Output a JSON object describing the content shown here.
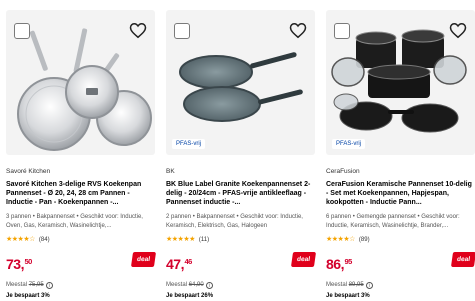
{
  "products": [
    {
      "brand": "Savoré Kitchen",
      "title": "Savoré Kitchen 3-delige RVS Koekenpan Pannenset - Ø 20, 24, 28 cm Pannen - Inductie - Pan - Koekenpannen -...",
      "description": "3 pannen • Bakpannenset • Geschikt voor: Inductie, Oven, Gas, Keramisch, Wasinelichtje,...",
      "stars": "★★★★☆",
      "review_count": "(84)",
      "price_main": "73,",
      "price_cents": "50",
      "deal_label": "deal",
      "was_label": "Meestal",
      "was_price": "75,95",
      "saving": "Je bespaart 3%",
      "pfas_label": ""
    },
    {
      "brand": "BK",
      "title": "BK Blue Label Granite Koekenpannenset 2-delig - 20/24cm - PFAS-vrije antikleeflaag - Pannenset inductie -...",
      "description": "2 pannen • Bakpannenset • Geschikt voor: Inductie, Keramisch, Elektrisch, Gas, Halogeen",
      "stars": "★★★★★",
      "review_count": "(11)",
      "price_main": "47,",
      "price_cents": "46",
      "deal_label": "deal",
      "was_label": "Meestal",
      "was_price": "64,90",
      "saving": "Je bespaart 26%",
      "pfas_label": "PFAS-vrij"
    },
    {
      "brand": "CeraFusion",
      "title": "CeraFusion Keramische Pannenset 10-delig - Set met Koekenpannen, Hapjespan, kookpotten - Inductie Pann...",
      "description": "6 pannen • Gemengde pannenset • Geschikt voor: Inductie, Keramisch, Wasinelichtje, Brander,...",
      "stars": "★★★★☆",
      "review_count": "(89)",
      "price_main": "86,",
      "price_cents": "95",
      "deal_label": "deal",
      "was_label": "Meestal",
      "was_price": "89,95",
      "saving": "Je bespaart 3%",
      "pfas_label": "PFAS-vrij"
    }
  ],
  "icons": {
    "heart": "heart-icon",
    "checkbox": "compare-checkbox",
    "info": "info-icon"
  },
  "colors": {
    "price": "#d3002c",
    "deal": "#e0001b",
    "stars": "#f4a300",
    "pfas_text": "#0042a5",
    "image_bg": "#f3f3f3"
  }
}
